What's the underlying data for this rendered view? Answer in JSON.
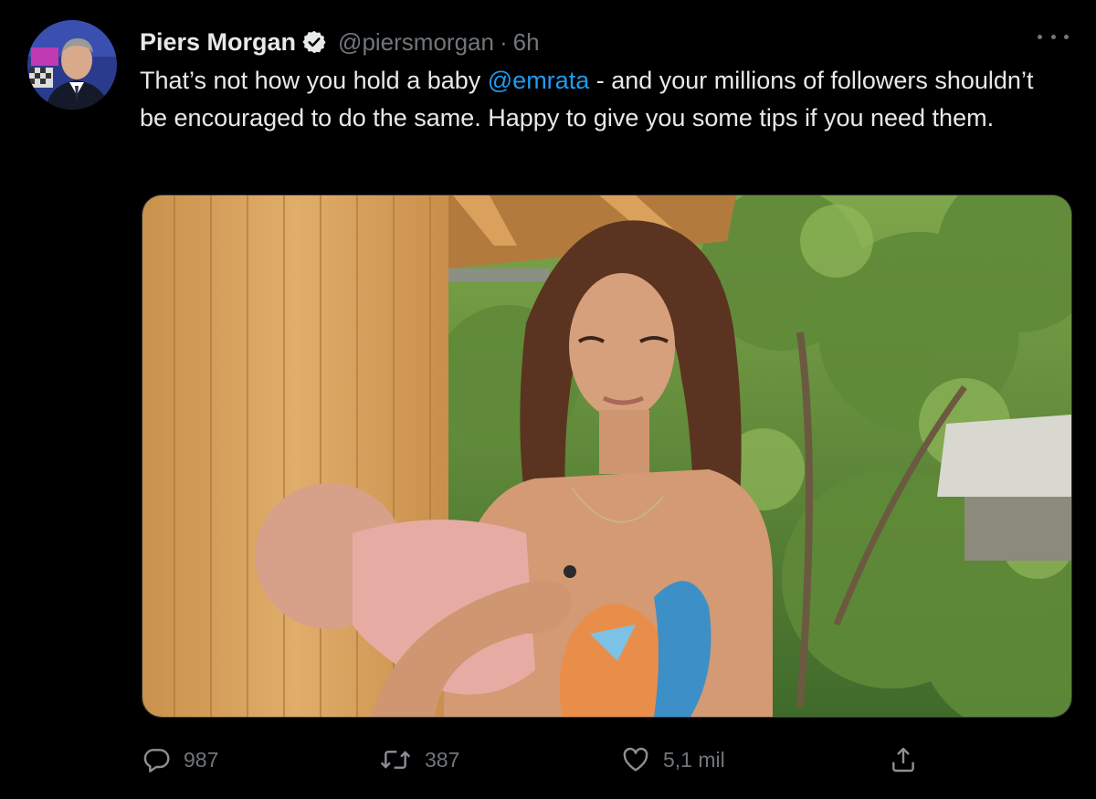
{
  "tweet": {
    "author": {
      "display_name": "Piers Morgan",
      "handle": "@piersmorgan",
      "verified": true
    },
    "separator": "·",
    "time": "6h",
    "text_before": "That’s not how you hold a baby ",
    "mention": "@emrata",
    "text_after": " - and your millions of followers shouldn’t be encouraged to do the same. Happy to give you some tips if you need them.",
    "actions": {
      "reply_count": "987",
      "retweet_count": "387",
      "like_count": "5,1 mil"
    }
  },
  "icons": {
    "verified": "verified-badge-icon",
    "more": "more-icon",
    "reply": "reply-icon",
    "retweet": "retweet-icon",
    "like": "heart-icon",
    "share": "share-icon"
  },
  "colors": {
    "background": "#000000",
    "text": "#e7e9ea",
    "secondary": "#71767b",
    "link": "#1d9bf0"
  }
}
